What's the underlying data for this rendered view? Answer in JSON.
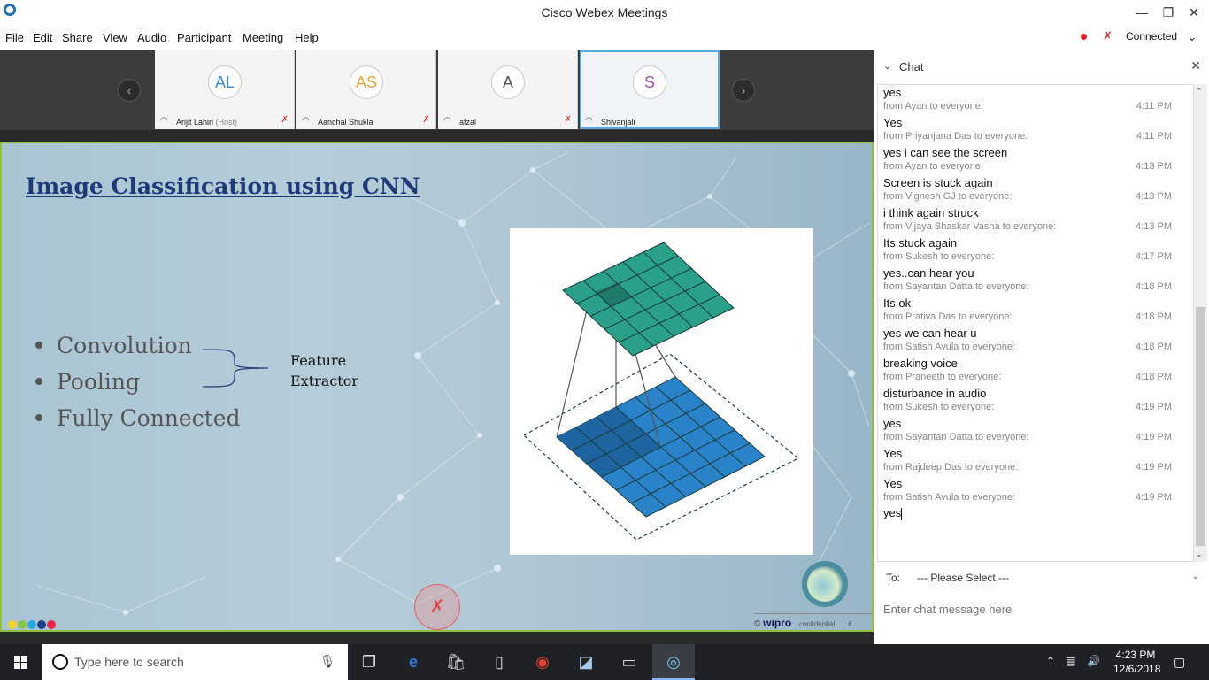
{
  "window": {
    "title": "Cisco Webex Meetings",
    "minimize": "—",
    "maximize": "❐",
    "close": "✕"
  },
  "menu": [
    "File",
    "Edit",
    "Share",
    "View",
    "Audio",
    "Participant",
    "Meeting",
    "Help"
  ],
  "status": {
    "connection": "Connected"
  },
  "participants": [
    {
      "initials": "AL",
      "name": "Arijit Lahiri",
      "role": "(Host)",
      "color": "#3a8fd0"
    },
    {
      "initials": "AS",
      "name": "Aanchal Shukla",
      "role": "",
      "color": "#e8a23a"
    },
    {
      "initials": "A",
      "name": "afzal",
      "role": "",
      "color": "#555555"
    },
    {
      "initials": "S",
      "name": "Shivanjali",
      "role": "",
      "color": "#a050b0"
    }
  ],
  "slide": {
    "title": "Image Classification using CNN",
    "bullets": [
      "Convolution",
      "Pooling",
      "Fully Connected"
    ],
    "feature_label_1": "Feature",
    "feature_label_2": "Extractor",
    "footer_copyright": "©",
    "footer_brand": "wipro",
    "footer_confidential": "confidential",
    "footer_page": "6"
  },
  "chat": {
    "title": "Chat",
    "first_message": "yes",
    "messages": [
      {
        "from": "from Ayan to everyone:",
        "time": "4:11 PM",
        "text": "Yes"
      },
      {
        "from": "from Priyanjana Das to everyone:",
        "time": "4:11 PM",
        "text": "yes i can see the screen"
      },
      {
        "from": "from Ayan to everyone:",
        "time": "4:13 PM",
        "text": "Screen is stuck again"
      },
      {
        "from": "from Vignesh GJ to everyone:",
        "time": "4:13 PM",
        "text": "i think again struck"
      },
      {
        "from": "from Vijaya Bhaskar Vasha to everyone:",
        "time": "4:13 PM",
        "text": "Its stuck again"
      },
      {
        "from": "from Sukesh to everyone:",
        "time": "4:17 PM",
        "text": "yes..can hear you"
      },
      {
        "from": "from Sayantan Datta to everyone:",
        "time": "4:18 PM",
        "text": "Its ok"
      },
      {
        "from": "from Prativa Das to everyone:",
        "time": "4:18 PM",
        "text": "yes we can hear u"
      },
      {
        "from": "from Satish Avula to everyone:",
        "time": "4:18 PM",
        "text": "breaking voice"
      },
      {
        "from": "from Praneeth to everyone:",
        "time": "4:18 PM",
        "text": "disturbance in audio"
      },
      {
        "from": "from Sukesh to everyone:",
        "time": "4:19 PM",
        "text": "yes"
      },
      {
        "from": "from Sayantan Datta to everyone:",
        "time": "4:19 PM",
        "text": "Yes"
      },
      {
        "from": "from Rajdeep Das to everyone:",
        "time": "4:19 PM",
        "text": "Yes"
      },
      {
        "from": "from Satish Avula to everyone:",
        "time": "4:19 PM",
        "text": ""
      }
    ],
    "last_message": "yes",
    "to_label": "To:",
    "to_value": "--- Please Select ---",
    "input_placeholder": "Enter chat message here"
  },
  "taskbar": {
    "search_placeholder": "Type here to search",
    "time": "4:23 PM",
    "date": "12/6/2018"
  },
  "colors": {
    "accent": "#5aa8e0",
    "slide_border": "#8fc13e",
    "title_blue": "#1f3a78",
    "mute_red": "#d33333"
  }
}
